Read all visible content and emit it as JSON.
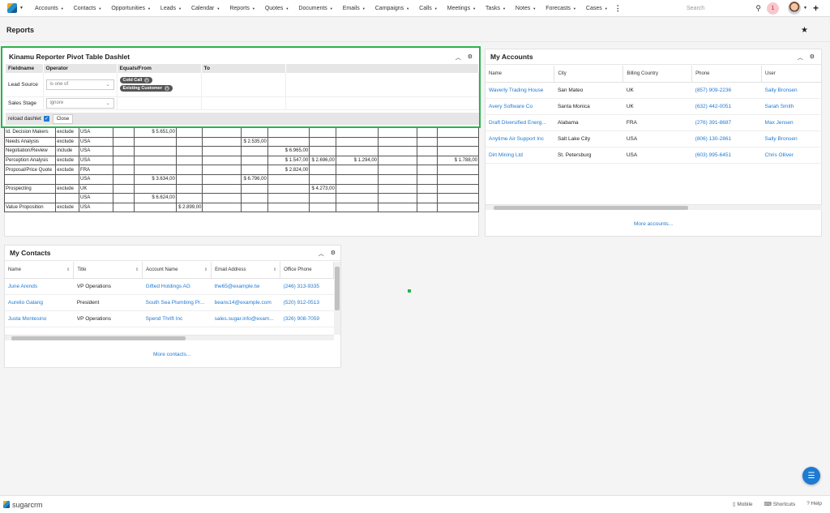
{
  "nav": {
    "items": [
      "Accounts",
      "Contacts",
      "Opportunities",
      "Leads",
      "Calendar",
      "Reports",
      "Quotes",
      "Documents",
      "Emails",
      "Campaigns",
      "Calls",
      "Meetings",
      "Tasks",
      "Notes",
      "Forecasts",
      "Cases"
    ],
    "search_placeholder": "Search",
    "notification_count": "1"
  },
  "page": {
    "title": "Reports"
  },
  "kinamu": {
    "title": "Kinamu Reporter Pivot Table Dashlet",
    "headers": [
      "Fieldname",
      "Operator",
      "Equals/From",
      "To"
    ],
    "rows": [
      {
        "field": "Lead Source",
        "operator": "is one of",
        "pills": [
          "Cold Call",
          "Existing Customer"
        ]
      },
      {
        "field": "Sales Stage",
        "operator": "ignore",
        "pills": []
      }
    ],
    "reload_label": "reload dashlet",
    "close_label": "Close"
  },
  "pivot": {
    "rows": [
      [
        "Id. Decision Makers",
        "exclude",
        "USA",
        "",
        "$ 5.651,00",
        "",
        "",
        "",
        "",
        "",
        "",
        "",
        "",
        ""
      ],
      [
        "Needs Analysis",
        "exclude",
        "USA",
        "",
        "",
        "",
        "",
        "$ 2.535,00",
        "",
        "",
        "",
        "",
        "",
        ""
      ],
      [
        "Negotiation/Review",
        "include",
        "USA",
        "",
        "",
        "",
        "",
        "",
        "$ 6.965,00",
        "",
        "",
        "",
        "",
        ""
      ],
      [
        "Perception Analysis",
        "exclude",
        "USA",
        "",
        "",
        "",
        "",
        "",
        "$ 1.547,00",
        "$ 2.696,00",
        "$ 1.294,00",
        "",
        "",
        "$ 1.788,00"
      ],
      [
        "Proposal/Price Quote",
        "exclude",
        "FRA",
        "",
        "",
        "",
        "",
        "",
        "$ 2.824,00",
        "",
        "",
        "",
        "",
        ""
      ],
      [
        "",
        "",
        "USA",
        "",
        "$ 3.634,00",
        "",
        "",
        "$ 6.796,00",
        "",
        "",
        "",
        "",
        "",
        ""
      ],
      [
        "Prospecting",
        "exclude",
        "UK",
        "",
        "",
        "",
        "",
        "",
        "",
        "$ 4.273,00",
        "",
        "",
        "",
        ""
      ],
      [
        "",
        "",
        "USA",
        "",
        "$ 6.624,00",
        "",
        "",
        "",
        "",
        "",
        "",
        "",
        "",
        ""
      ],
      [
        "Value Proposition",
        "exclude",
        "USA",
        "",
        "",
        "$ 2.899,00",
        "",
        "",
        "",
        "",
        "",
        "",
        "",
        ""
      ]
    ]
  },
  "accounts": {
    "title": "My Accounts",
    "columns": [
      "Name",
      "City",
      "Billing Country",
      "Phone",
      "User"
    ],
    "rows": [
      [
        "Waverly Trading House",
        "San Mateo",
        "UK",
        "(857) 909-2236",
        "Sally Bronsen"
      ],
      [
        "Avery Software Co",
        "Santa Monica",
        "UK",
        "(632) 442-0051",
        "Sarah Smith"
      ],
      [
        "Draft Diversified Energ...",
        "Alabama",
        "FRA",
        "(276) 391-8687",
        "Max Jensen"
      ],
      [
        "Anytime Air Support Inc",
        "Salt Lake City",
        "USA",
        "(806) 130-2861",
        "Sally Bronsen"
      ],
      [
        "Dirt Mining Ltd",
        "St. Petersburg",
        "USA",
        "(603) 995-6451",
        "Chris Olliver"
      ]
    ],
    "more": "More accounts..."
  },
  "contacts": {
    "title": "My Contacts",
    "columns": [
      "Name",
      "Title",
      "Account Name",
      "Email Address",
      "Office Phone"
    ],
    "rows": [
      [
        "June Arends",
        "VP Operations",
        "Gifted Holdings AG",
        "the65@example.tw",
        "(246) 313-9335"
      ],
      [
        "Aurelio Galang",
        "President",
        "South Sea Plumbing Pr...",
        "beans14@example.com",
        "(520) 912-0513"
      ],
      [
        "Justa Montesino",
        "VP Operations",
        "Spend Thrift Inc",
        "sales.sugar.info@exam...",
        "(326) 908-7059"
      ]
    ],
    "more": "More contacts..."
  },
  "footer": {
    "brand": "sugarcrm",
    "links": [
      "Mobile",
      "Shortcuts",
      "Help"
    ]
  }
}
